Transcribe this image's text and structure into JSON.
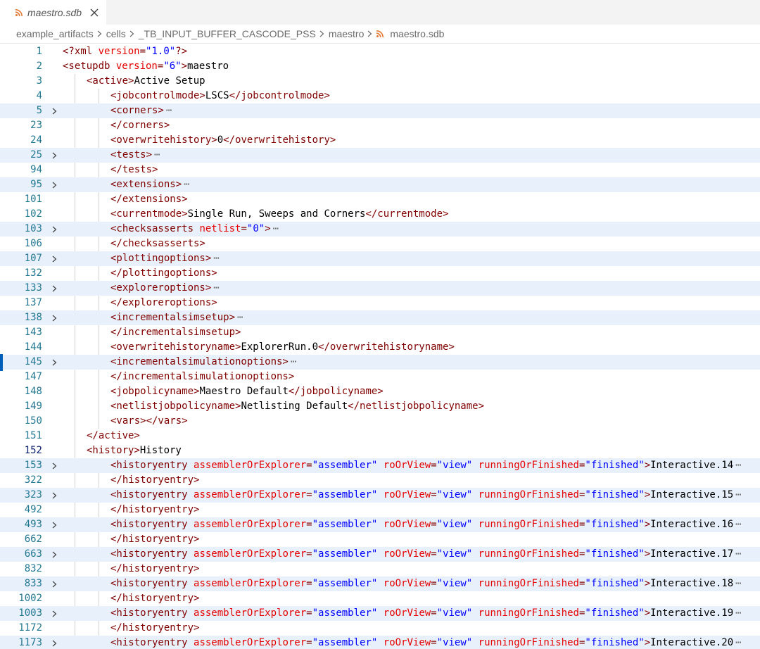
{
  "tab": {
    "filename": "maestro.sdb"
  },
  "breadcrumb": {
    "segments": [
      "example_artifacts",
      "cells",
      "_TB_INPUT_BUFFER_CASCODE_PSS",
      "maestro",
      "maestro.sdb"
    ]
  },
  "editor": {
    "lines": [
      {
        "n": "1",
        "indent": 0,
        "fold": false,
        "parts": [
          [
            "t",
            "<?xml "
          ],
          [
            "a",
            "version"
          ],
          [
            "t",
            "="
          ],
          [
            "v",
            "\"1.0\""
          ],
          [
            "t",
            "?>"
          ]
        ]
      },
      {
        "n": "2",
        "indent": 0,
        "fold": false,
        "parts": [
          [
            "t",
            "<setupdb "
          ],
          [
            "a",
            "version"
          ],
          [
            "t",
            "="
          ],
          [
            "v",
            "\"6\""
          ],
          [
            "t",
            ">"
          ],
          [
            "x",
            "maestro"
          ]
        ]
      },
      {
        "n": "3",
        "indent": 1,
        "fold": false,
        "parts": [
          [
            "t",
            "<active>"
          ],
          [
            "x",
            "Active Setup"
          ]
        ]
      },
      {
        "n": "4",
        "indent": 2,
        "fold": false,
        "parts": [
          [
            "t",
            "<jobcontrolmode>"
          ],
          [
            "x",
            "LSCS"
          ],
          [
            "t",
            "</jobcontrolmode>"
          ]
        ]
      },
      {
        "n": "5",
        "indent": 2,
        "fold": true,
        "parts": [
          [
            "t",
            "<corners>"
          ]
        ]
      },
      {
        "n": "23",
        "indent": 2,
        "fold": false,
        "parts": [
          [
            "t",
            "</corners>"
          ]
        ]
      },
      {
        "n": "24",
        "indent": 2,
        "fold": false,
        "parts": [
          [
            "t",
            "<overwritehistory>"
          ],
          [
            "x",
            "0"
          ],
          [
            "t",
            "</overwritehistory>"
          ]
        ]
      },
      {
        "n": "25",
        "indent": 2,
        "fold": true,
        "parts": [
          [
            "t",
            "<tests>"
          ]
        ]
      },
      {
        "n": "94",
        "indent": 2,
        "fold": false,
        "parts": [
          [
            "t",
            "</tests>"
          ]
        ]
      },
      {
        "n": "95",
        "indent": 2,
        "fold": true,
        "parts": [
          [
            "t",
            "<extensions>"
          ]
        ]
      },
      {
        "n": "101",
        "indent": 2,
        "fold": false,
        "parts": [
          [
            "t",
            "</extensions>"
          ]
        ]
      },
      {
        "n": "102",
        "indent": 2,
        "fold": false,
        "parts": [
          [
            "t",
            "<currentmode>"
          ],
          [
            "x",
            "Single Run, Sweeps and Corners"
          ],
          [
            "t",
            "</currentmode>"
          ]
        ]
      },
      {
        "n": "103",
        "indent": 2,
        "fold": true,
        "parts": [
          [
            "t",
            "<checksasserts "
          ],
          [
            "a",
            "netlist"
          ],
          [
            "t",
            "="
          ],
          [
            "v",
            "\"0\""
          ],
          [
            "t",
            ">"
          ]
        ]
      },
      {
        "n": "106",
        "indent": 2,
        "fold": false,
        "parts": [
          [
            "t",
            "</checksasserts>"
          ]
        ]
      },
      {
        "n": "107",
        "indent": 2,
        "fold": true,
        "parts": [
          [
            "t",
            "<plottingoptions>"
          ]
        ]
      },
      {
        "n": "132",
        "indent": 2,
        "fold": false,
        "parts": [
          [
            "t",
            "</plottingoptions>"
          ]
        ]
      },
      {
        "n": "133",
        "indent": 2,
        "fold": true,
        "parts": [
          [
            "t",
            "<exploreroptions>"
          ]
        ]
      },
      {
        "n": "137",
        "indent": 2,
        "fold": false,
        "parts": [
          [
            "t",
            "</exploreroptions>"
          ]
        ]
      },
      {
        "n": "138",
        "indent": 2,
        "fold": true,
        "parts": [
          [
            "t",
            "<incrementalsimsetup>"
          ]
        ]
      },
      {
        "n": "143",
        "indent": 2,
        "fold": false,
        "parts": [
          [
            "t",
            "</incrementalsimsetup>"
          ]
        ]
      },
      {
        "n": "144",
        "indent": 2,
        "fold": false,
        "parts": [
          [
            "t",
            "<overwritehistoryname>"
          ],
          [
            "x",
            "ExplorerRun.0"
          ],
          [
            "t",
            "</overwritehistoryname>"
          ]
        ]
      },
      {
        "n": "145",
        "indent": 2,
        "fold": true,
        "parts": [
          [
            "t",
            "<incrementalsimulationoptions>"
          ]
        ]
      },
      {
        "n": "147",
        "indent": 2,
        "fold": false,
        "parts": [
          [
            "t",
            "</incrementalsimulationoptions>"
          ]
        ]
      },
      {
        "n": "148",
        "indent": 2,
        "fold": false,
        "parts": [
          [
            "t",
            "<jobpolicyname>"
          ],
          [
            "x",
            "Maestro Default"
          ],
          [
            "t",
            "</jobpolicyname>"
          ]
        ]
      },
      {
        "n": "149",
        "indent": 2,
        "fold": false,
        "parts": [
          [
            "t",
            "<netlistjobpolicyname>"
          ],
          [
            "x",
            "Netlisting Default"
          ],
          [
            "t",
            "</netlistjobpolicyname>"
          ]
        ]
      },
      {
        "n": "150",
        "indent": 2,
        "fold": false,
        "parts": [
          [
            "t",
            "<vars></vars>"
          ]
        ]
      },
      {
        "n": "151",
        "indent": 1,
        "fold": false,
        "parts": [
          [
            "t",
            "</active>"
          ]
        ]
      },
      {
        "n": "152",
        "indent": 1,
        "fold": false,
        "current": true,
        "parts": [
          [
            "t",
            "<history>"
          ],
          [
            "x",
            "History"
          ]
        ]
      },
      {
        "n": "153",
        "indent": 2,
        "fold": true,
        "parts": [
          [
            "t",
            "<historyentry "
          ],
          [
            "a",
            "assemblerOrExplorer"
          ],
          [
            "t",
            "="
          ],
          [
            "v",
            "\"assembler\""
          ],
          [
            "t",
            " "
          ],
          [
            "a",
            "roOrView"
          ],
          [
            "t",
            "="
          ],
          [
            "v",
            "\"view\""
          ],
          [
            "t",
            " "
          ],
          [
            "a",
            "runningOrFinished"
          ],
          [
            "t",
            "="
          ],
          [
            "v",
            "\"finished\""
          ],
          [
            "t",
            ">"
          ],
          [
            "x",
            "Interactive.14"
          ]
        ]
      },
      {
        "n": "322",
        "indent": 2,
        "fold": false,
        "parts": [
          [
            "t",
            "</historyentry>"
          ]
        ]
      },
      {
        "n": "323",
        "indent": 2,
        "fold": true,
        "parts": [
          [
            "t",
            "<historyentry "
          ],
          [
            "a",
            "assemblerOrExplorer"
          ],
          [
            "t",
            "="
          ],
          [
            "v",
            "\"assembler\""
          ],
          [
            "t",
            " "
          ],
          [
            "a",
            "roOrView"
          ],
          [
            "t",
            "="
          ],
          [
            "v",
            "\"view\""
          ],
          [
            "t",
            " "
          ],
          [
            "a",
            "runningOrFinished"
          ],
          [
            "t",
            "="
          ],
          [
            "v",
            "\"finished\""
          ],
          [
            "t",
            ">"
          ],
          [
            "x",
            "Interactive.15"
          ]
        ]
      },
      {
        "n": "492",
        "indent": 2,
        "fold": false,
        "parts": [
          [
            "t",
            "</historyentry>"
          ]
        ]
      },
      {
        "n": "493",
        "indent": 2,
        "fold": true,
        "parts": [
          [
            "t",
            "<historyentry "
          ],
          [
            "a",
            "assemblerOrExplorer"
          ],
          [
            "t",
            "="
          ],
          [
            "v",
            "\"assembler\""
          ],
          [
            "t",
            " "
          ],
          [
            "a",
            "roOrView"
          ],
          [
            "t",
            "="
          ],
          [
            "v",
            "\"view\""
          ],
          [
            "t",
            " "
          ],
          [
            "a",
            "runningOrFinished"
          ],
          [
            "t",
            "="
          ],
          [
            "v",
            "\"finished\""
          ],
          [
            "t",
            ">"
          ],
          [
            "x",
            "Interactive.16"
          ]
        ]
      },
      {
        "n": "662",
        "indent": 2,
        "fold": false,
        "parts": [
          [
            "t",
            "</historyentry>"
          ]
        ]
      },
      {
        "n": "663",
        "indent": 2,
        "fold": true,
        "parts": [
          [
            "t",
            "<historyentry "
          ],
          [
            "a",
            "assemblerOrExplorer"
          ],
          [
            "t",
            "="
          ],
          [
            "v",
            "\"assembler\""
          ],
          [
            "t",
            " "
          ],
          [
            "a",
            "roOrView"
          ],
          [
            "t",
            "="
          ],
          [
            "v",
            "\"view\""
          ],
          [
            "t",
            " "
          ],
          [
            "a",
            "runningOrFinished"
          ],
          [
            "t",
            "="
          ],
          [
            "v",
            "\"finished\""
          ],
          [
            "t",
            ">"
          ],
          [
            "x",
            "Interactive.17"
          ]
        ]
      },
      {
        "n": "832",
        "indent": 2,
        "fold": false,
        "parts": [
          [
            "t",
            "</historyentry>"
          ]
        ]
      },
      {
        "n": "833",
        "indent": 2,
        "fold": true,
        "parts": [
          [
            "t",
            "<historyentry "
          ],
          [
            "a",
            "assemblerOrExplorer"
          ],
          [
            "t",
            "="
          ],
          [
            "v",
            "\"assembler\""
          ],
          [
            "t",
            " "
          ],
          [
            "a",
            "roOrView"
          ],
          [
            "t",
            "="
          ],
          [
            "v",
            "\"view\""
          ],
          [
            "t",
            " "
          ],
          [
            "a",
            "runningOrFinished"
          ],
          [
            "t",
            "="
          ],
          [
            "v",
            "\"finished\""
          ],
          [
            "t",
            ">"
          ],
          [
            "x",
            "Interactive.18"
          ]
        ]
      },
      {
        "n": "1002",
        "indent": 2,
        "fold": false,
        "parts": [
          [
            "t",
            "</historyentry>"
          ]
        ]
      },
      {
        "n": "1003",
        "indent": 2,
        "fold": true,
        "parts": [
          [
            "t",
            "<historyentry "
          ],
          [
            "a",
            "assemblerOrExplorer"
          ],
          [
            "t",
            "="
          ],
          [
            "v",
            "\"assembler\""
          ],
          [
            "t",
            " "
          ],
          [
            "a",
            "roOrView"
          ],
          [
            "t",
            "="
          ],
          [
            "v",
            "\"view\""
          ],
          [
            "t",
            " "
          ],
          [
            "a",
            "runningOrFinished"
          ],
          [
            "t",
            "="
          ],
          [
            "v",
            "\"finished\""
          ],
          [
            "t",
            ">"
          ],
          [
            "x",
            "Interactive.19"
          ]
        ]
      },
      {
        "n": "1172",
        "indent": 2,
        "fold": false,
        "parts": [
          [
            "t",
            "</historyentry>"
          ]
        ]
      },
      {
        "n": "1173",
        "indent": 2,
        "fold": true,
        "parts": [
          [
            "t",
            "<historyentry "
          ],
          [
            "a",
            "assemblerOrExplorer"
          ],
          [
            "t",
            "="
          ],
          [
            "v",
            "\"assembler\""
          ],
          [
            "t",
            " "
          ],
          [
            "a",
            "roOrView"
          ],
          [
            "t",
            "="
          ],
          [
            "v",
            "\"view\""
          ],
          [
            "t",
            " "
          ],
          [
            "a",
            "runningOrFinished"
          ],
          [
            "t",
            "="
          ],
          [
            "v",
            "\"finished\""
          ],
          [
            "t",
            ">"
          ],
          [
            "x",
            "Interactive.20"
          ]
        ]
      }
    ]
  },
  "colors": {
    "tag": "#800000",
    "attribute": "#e50000",
    "value": "#0000ff",
    "line_number": "#237893",
    "folded_background": "#e8f1fb",
    "rss_icon": "#e37933"
  }
}
